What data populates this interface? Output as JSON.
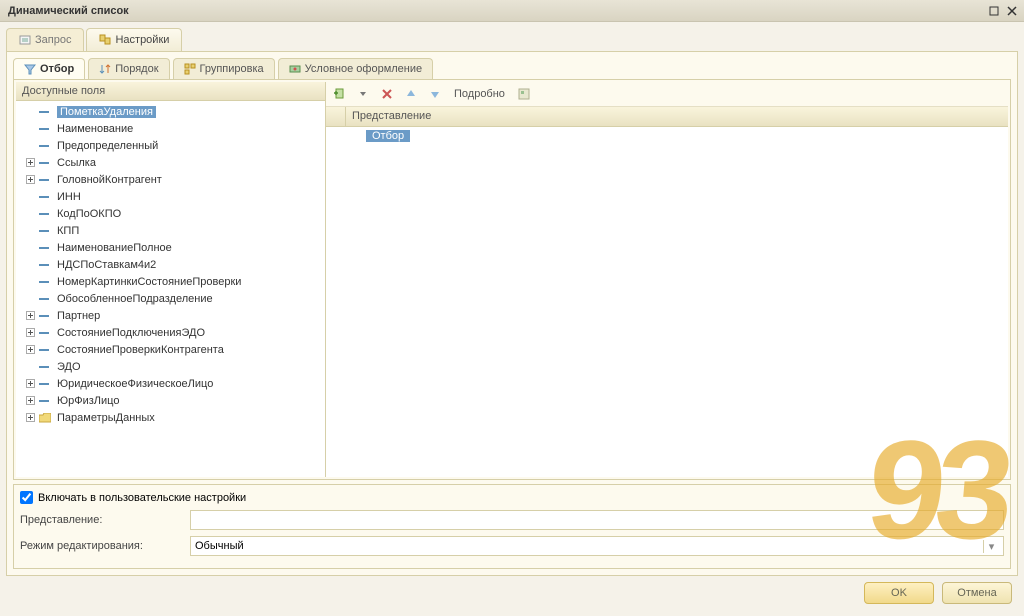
{
  "window": {
    "title": "Динамический список"
  },
  "topTabs": {
    "query": "Запрос",
    "settings": "Настройки"
  },
  "subTabs": {
    "filter": "Отбор",
    "order": "Порядок",
    "group": "Группировка",
    "condformat": "Условное оформление"
  },
  "leftHeader": "Доступные поля",
  "tree": {
    "items": [
      {
        "label": "ПометкаУдаления",
        "expand": "",
        "kind": "attr",
        "selected": true
      },
      {
        "label": "Наименование",
        "expand": "",
        "kind": "attr"
      },
      {
        "label": "Предопределенный",
        "expand": "",
        "kind": "attr"
      },
      {
        "label": "Ссылка",
        "expand": "+",
        "kind": "attr"
      },
      {
        "label": "ГоловнойКонтрагент",
        "expand": "+",
        "kind": "attr"
      },
      {
        "label": "ИНН",
        "expand": "",
        "kind": "attr"
      },
      {
        "label": "КодПоОКПО",
        "expand": "",
        "kind": "attr"
      },
      {
        "label": "КПП",
        "expand": "",
        "kind": "attr"
      },
      {
        "label": "НаименованиеПолное",
        "expand": "",
        "kind": "attr"
      },
      {
        "label": "НДСПоСтавкам4и2",
        "expand": "",
        "kind": "attr"
      },
      {
        "label": "НомерКартинкиСостояниеПроверки",
        "expand": "",
        "kind": "attr"
      },
      {
        "label": "ОбособленноеПодразделение",
        "expand": "",
        "kind": "attr"
      },
      {
        "label": "Партнер",
        "expand": "+",
        "kind": "attr"
      },
      {
        "label": "СостояниеПодключенияЭДО",
        "expand": "+",
        "kind": "attr"
      },
      {
        "label": "СостояниеПроверкиКонтрагента",
        "expand": "+",
        "kind": "attr"
      },
      {
        "label": "ЭДО",
        "expand": "",
        "kind": "attr"
      },
      {
        "label": "ЮридическоеФизическоеЛицо",
        "expand": "+",
        "kind": "attr"
      },
      {
        "label": "ЮрФизЛицо",
        "expand": "+",
        "kind": "attr"
      },
      {
        "label": "ПараметрыДанных",
        "expand": "+",
        "kind": "folder"
      }
    ]
  },
  "toolbar": {
    "details": "Подробно"
  },
  "rightHeader": "Представление",
  "rightRow": "Отбор",
  "bottom": {
    "include": "Включать в пользовательские настройки",
    "represLabel": "Представление:",
    "represValue": "",
    "modeLabel": "Режим редактирования:",
    "modeValue": "Обычный"
  },
  "footer": {
    "ok": "OK",
    "cancel": "Отмена"
  },
  "watermark": "93"
}
